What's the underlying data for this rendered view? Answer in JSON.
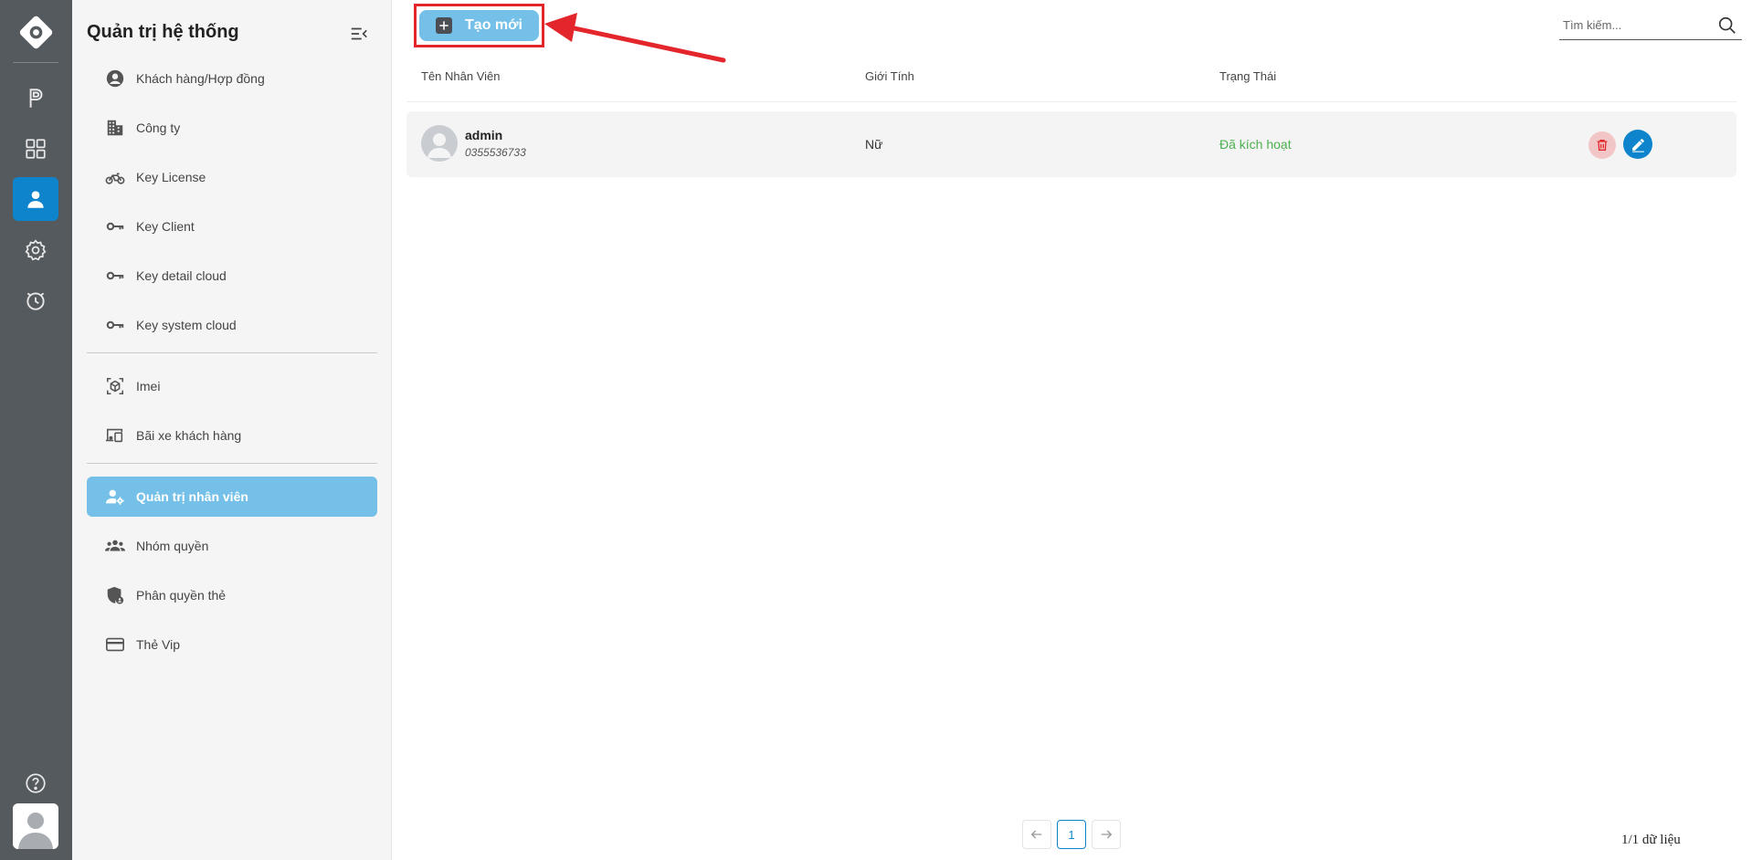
{
  "sidebar": {
    "title": "Quản trị hệ thống",
    "items": [
      {
        "label": "Khách hàng/Hợp đồng",
        "icon": "user-circle-icon"
      },
      {
        "label": "Công ty",
        "icon": "building-icon"
      },
      {
        "label": "Key License",
        "icon": "motorbike-icon"
      },
      {
        "label": "Key Client",
        "icon": "key-icon"
      },
      {
        "label": "Key detail cloud",
        "icon": "key-icon"
      },
      {
        "label": "Key system cloud",
        "icon": "key-icon"
      },
      {
        "label": "Imei",
        "icon": "cube-scan-icon"
      },
      {
        "label": "Bãi xe khách hàng",
        "icon": "devices-icon"
      },
      {
        "label": "Quản trị nhân viên",
        "icon": "user-gear-icon"
      },
      {
        "label": "Nhóm quyền",
        "icon": "group-icon"
      },
      {
        "label": "Phân quyền thẻ",
        "icon": "shield-user-icon"
      },
      {
        "label": "Thẻ Vip",
        "icon": "card-icon"
      }
    ]
  },
  "toolbar": {
    "create_label": "Tạo mới",
    "search_placeholder": "Tìm kiếm..."
  },
  "table": {
    "columns": [
      "Tên Nhân Viên",
      "Giới Tính",
      "Trạng Thái"
    ],
    "rows": [
      {
        "name": "admin",
        "phone": "0355536733",
        "gender": "Nữ",
        "status": "Đã kích hoạt"
      }
    ]
  },
  "pagination": {
    "current_page": "1",
    "summary": "1/1 dữ liệu"
  },
  "colors": {
    "accent": "#0d84cc",
    "active_menu": "#74c0e8",
    "status_active": "#4caf50",
    "highlight": "#e3262b"
  }
}
